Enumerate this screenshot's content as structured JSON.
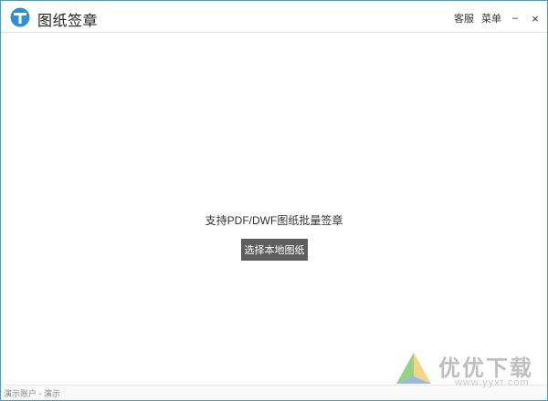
{
  "app": {
    "title": "图纸签章"
  },
  "header": {
    "service_label": "客服",
    "menu_label": "菜单",
    "minimize_label": "–",
    "close_label": "×"
  },
  "main": {
    "hint": "支持PDF/DWF图纸批量签章",
    "select_button_label": "选择本地图纸"
  },
  "status": {
    "text": "演示账户 - 演示"
  },
  "watermark": {
    "brand": "优优下载",
    "url": "www.yyxt.com"
  },
  "colors": {
    "accent": "#3aa0d8",
    "button_bg": "#5e5e5e"
  }
}
